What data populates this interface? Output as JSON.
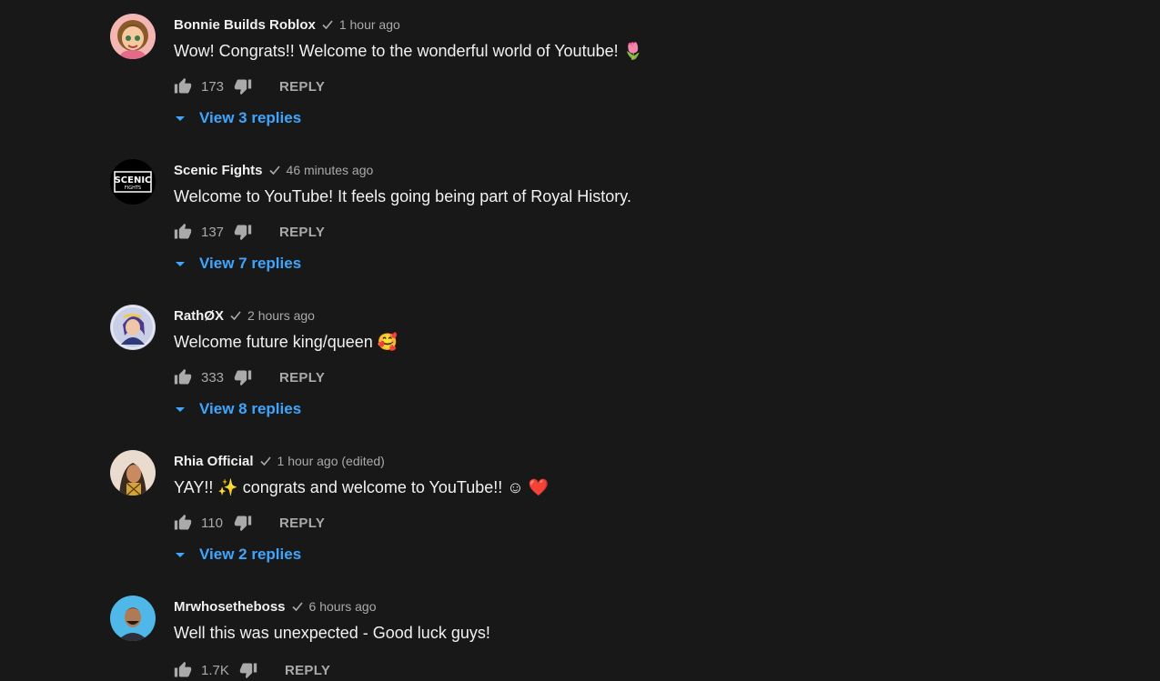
{
  "comments": [
    {
      "author": "Bonnie Builds Roblox",
      "time": "1 hour ago",
      "text": "Wow! Congrats!! Welcome to the wonderful world of Youtube! 🌷",
      "likes": "173",
      "reply_label": "REPLY",
      "view_replies": "View 3 replies",
      "avatar": "cartoon-girl-avatar"
    },
    {
      "author": "Scenic Fights",
      "time": "46 minutes ago",
      "text": "Welcome to YouTube! It feels going being part of Royal History.",
      "likes": "137",
      "reply_label": "REPLY",
      "view_replies": "View 7 replies",
      "avatar": "scenic-fights-logo-avatar",
      "avatar_text": "SCENIC",
      "avatar_subtext": "FIGHTS"
    },
    {
      "author": "RathØX",
      "time": "2 hours ago",
      "text": "Welcome future king/queen 🥰",
      "likes": "333",
      "reply_label": "REPLY",
      "view_replies": "View 8 replies",
      "avatar": "illustrated-character-avatar"
    },
    {
      "author": "Rhia Official",
      "time": "1 hour ago (edited)",
      "text": "YAY!! ✨ congrats and welcome to YouTube!! ☺ ❤️",
      "likes": "110",
      "reply_label": "REPLY",
      "view_replies": "View 2 replies",
      "avatar": "photo-person-avatar"
    },
    {
      "author": "Mrwhosetheboss",
      "time": "6 hours ago",
      "text": "Well this was unexpected - Good luck guys!",
      "likes": "1.7K",
      "reply_label": "REPLY",
      "avatar": "photo-man-avatar"
    }
  ],
  "colors": {
    "background": "#181818",
    "text": "#f1f1f1",
    "muted": "#aaaaaa",
    "link": "#3ea6ff"
  },
  "icons": [
    "verified-check-icon",
    "thumbs-up-icon",
    "thumbs-down-icon",
    "caret-down-icon"
  ]
}
